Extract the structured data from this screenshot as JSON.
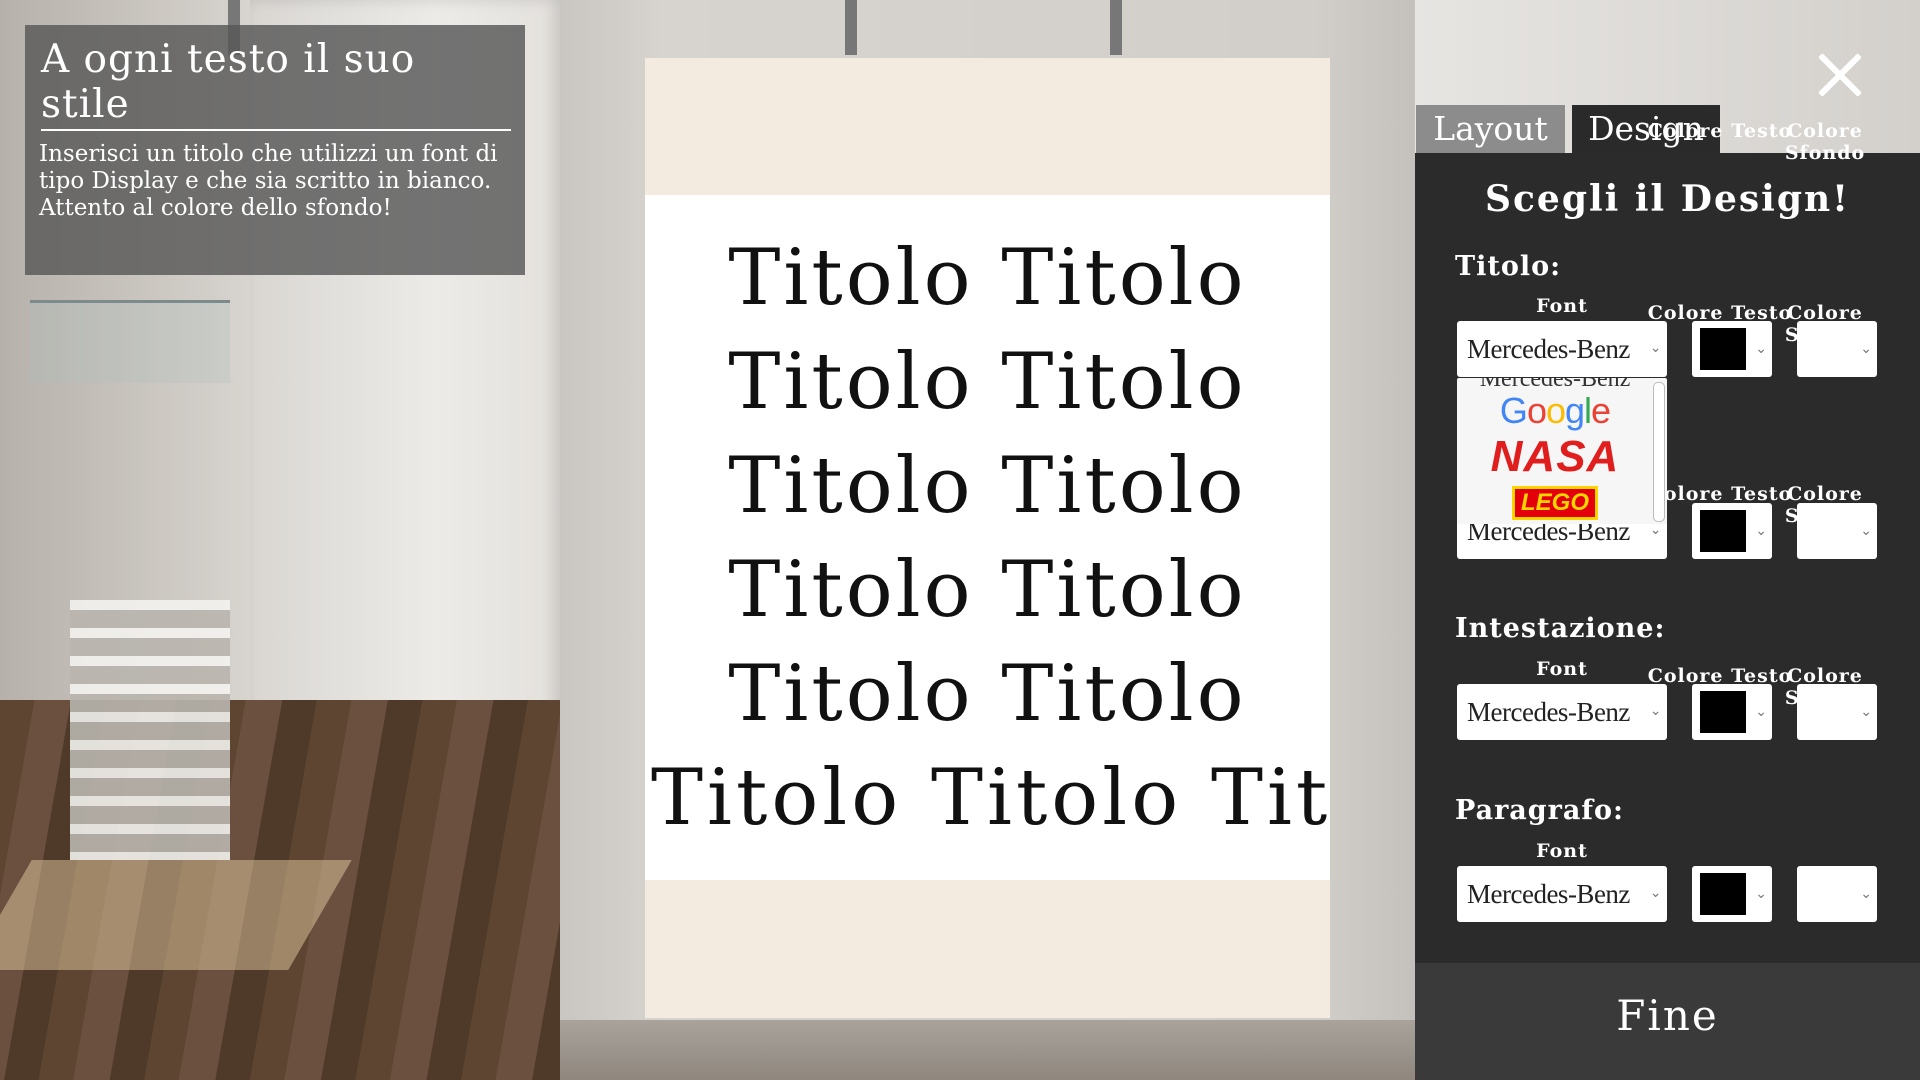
{
  "instructions": {
    "title": "A ogni testo il suo stile",
    "body": "Inserisci un titolo che utilizzi un font di tipo Display e che sia scritto in bianco. Attento al colore dello sfondo!"
  },
  "poster": {
    "lines": [
      "Titolo Titolo",
      "Titolo Titolo",
      "Titolo Titolo",
      "Titolo Titolo",
      "Titolo Titolo",
      "Titolo Titolo  Tit"
    ]
  },
  "tabs": {
    "layout": "Layout",
    "design": "Design"
  },
  "panel": {
    "title": "Scegli il Design!",
    "col_font": "Font",
    "col_text_color": "Colore Testo",
    "col_bg_color": "Colore Sfondo",
    "sections": {
      "titolo": {
        "label": "Titolo:",
        "font": "Mercedes-Benz",
        "text_color": "#000000",
        "bg_color": "#ffffff"
      },
      "sottotitolo": {
        "font": "Mercedes-Benz",
        "text_color": "#000000",
        "bg_color": "#ffffff"
      },
      "intestazione": {
        "label": "Intestazione:",
        "font": "Mercedes-Benz",
        "text_color": "#000000",
        "bg_color": "#ffffff"
      },
      "paragrafo": {
        "label": "Paragrafo:",
        "font": "Mercedes-Benz",
        "text_color": "#000000",
        "bg_color": "#ffffff"
      }
    },
    "dropdown_options": [
      "Mercedes-Benz",
      "Google",
      "NASA",
      "LEGO"
    ]
  },
  "fine_label": "Fine",
  "icons": {
    "close": "close-icon",
    "chevron": "chevron-down-icon"
  }
}
